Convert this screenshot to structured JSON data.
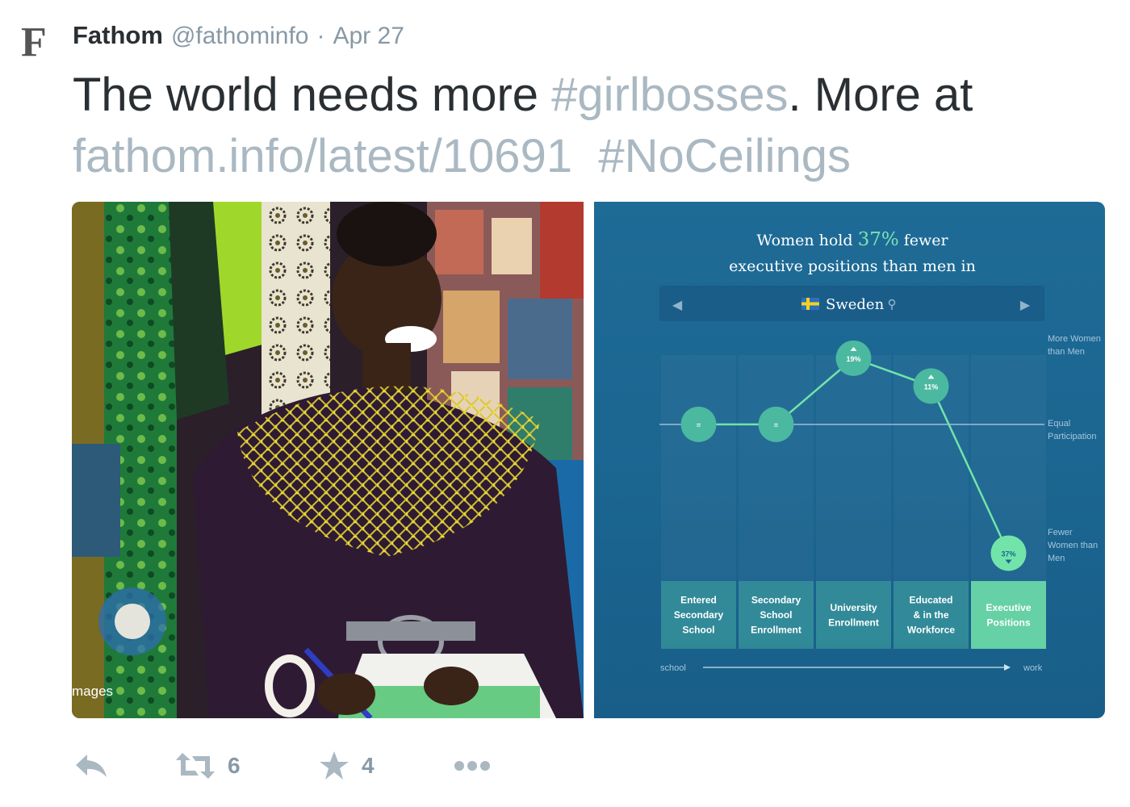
{
  "tweet": {
    "avatar_letter": "F",
    "author_name": "Fathom",
    "handle": "@fathominfo",
    "separator": "·",
    "date": "Apr 27",
    "text_part1": "The world needs more ",
    "hashtag1": "#girlbosses",
    "text_part2": ". More at",
    "link": "fathom.info/latest/10691",
    "hashtag2": "#NoCeilings"
  },
  "photo": {
    "caption": "mages"
  },
  "infographic": {
    "title_pre": "Women hold ",
    "title_highlight": "37%",
    "title_post": " fewer",
    "title_line2": "executive positions than men in",
    "country": "Sweden",
    "left_arrow": "◀",
    "right_arrow": "▶",
    "pin_icon": "location-pin-icon",
    "axis_labels": {
      "more_line1": "More Women",
      "more_line2": "than Men",
      "equal_line1": "Equal",
      "equal_line2": "Participation",
      "fewer_line1": "Fewer",
      "fewer_line2": "Women than",
      "fewer_line3": "Men"
    },
    "flow": {
      "start": "school",
      "end": "work"
    },
    "colors": {
      "accent": "#7be3b3",
      "node": "#4bb8a0",
      "node_highlight": "#72e4a9",
      "background": "#1b6591"
    }
  },
  "chart_data": {
    "type": "line",
    "title": "Women hold 37% fewer executive positions than men in Sweden",
    "categories": [
      "Entered Secondary School",
      "Secondary School Enrollment",
      "University Enrollment",
      "Educated & in the Workforce",
      "Executive Positions"
    ],
    "category_lines": [
      [
        "Entered",
        "Secondary",
        "School"
      ],
      [
        "Secondary",
        "School",
        "Enrollment"
      ],
      [
        "University",
        "Enrollment"
      ],
      [
        "Educated",
        "& in the",
        "Workforce"
      ],
      [
        "Executive",
        "Positions"
      ]
    ],
    "values": [
      0,
      0,
      19,
      11,
      -37
    ],
    "labels": [
      "=",
      "=",
      "19%",
      "11%",
      "37%"
    ],
    "ylim": [
      -45,
      25
    ],
    "zero_label": "Equal Participation"
  },
  "actions": {
    "reply_icon": "reply-icon",
    "retweet_icon": "retweet-icon",
    "retweet_count": "6",
    "favorite_icon": "star-icon",
    "favorite_count": "4",
    "more_icon": "more-dots-icon"
  }
}
